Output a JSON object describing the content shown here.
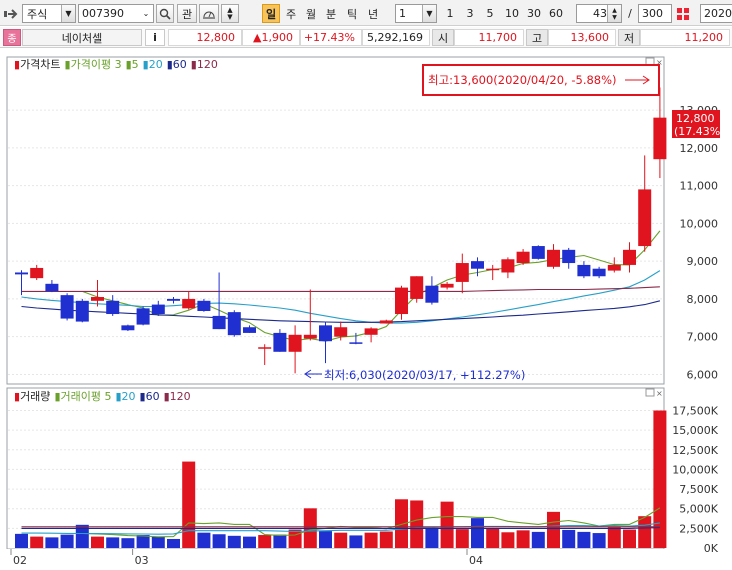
{
  "toolbar": {
    "market_select": "주식",
    "code_input": "007390",
    "gwan_label": "관",
    "period_buttons": [
      "일",
      "주",
      "월",
      "분",
      "틱",
      "년"
    ],
    "active_period": "일",
    "interval_value": "1",
    "quick_intervals": [
      "1",
      "3",
      "5",
      "10",
      "30",
      "60"
    ],
    "count_value": "43",
    "slash": "/",
    "total_value": "300",
    "date_value": "2020/"
  },
  "quote": {
    "name_badge": "종",
    "stock_name": "네이처셀",
    "info_btn": "i",
    "price": "12,800",
    "change": "▲1,900",
    "change_rate": "+17.43%",
    "volume": "5,292,169",
    "open_label": "시",
    "open": "11,700",
    "high_label": "고",
    "high": "13,600",
    "low_label": "저",
    "low": "11,200"
  },
  "colors": {
    "up": "#e0141e",
    "down": "#1f2fd0",
    "ma5": "#6aa12a",
    "ma20": "#27a0c9",
    "ma60": "#1c2a8c",
    "ma120": "#8b2a4b",
    "callout": "#e0141e"
  },
  "price_panel": {
    "legend": [
      {
        "text": "가격차트",
        "color": "#222"
      },
      {
        "text": "가격이평 3",
        "color": "#6aa12a"
      },
      {
        "text": "5",
        "color": "#6aa12a"
      },
      {
        "text": "20",
        "color": "#27a0c9"
      },
      {
        "text": "60",
        "color": "#1c2a8c"
      },
      {
        "text": "120",
        "color": "#8b2a4b"
      }
    ],
    "high_callout": "최고:13,600(2020/04/20, -5.88%)",
    "low_callout": "최저:6,030(2020/03/17, +112.27%)",
    "last_price_tag": "12,800",
    "last_rate_tag": "(17.43%)"
  },
  "volume_panel": {
    "legend": [
      {
        "text": "거래량",
        "color": "#222"
      },
      {
        "text": "거래이평 5",
        "color": "#6aa12a"
      },
      {
        "text": "20",
        "color": "#27a0c9"
      },
      {
        "text": "60",
        "color": "#1c2a8c"
      },
      {
        "text": "120",
        "color": "#8b2a4b"
      }
    ]
  },
  "chart_data": {
    "type": "candlestick",
    "price_axis_ticks": [
      "13,000",
      "12,000",
      "11,000",
      "10,000",
      "9,000",
      "8,000",
      "7,000",
      "6,000"
    ],
    "price_ylim": [
      5800,
      14300
    ],
    "volume_axis_ticks": [
      "17,500K",
      "15,000K",
      "12,500K",
      "10,000K",
      "7,500K",
      "5,000K",
      "2,500K",
      "0K"
    ],
    "volume_ylim": [
      0,
      18200
    ],
    "x_labels": [
      {
        "text": "02",
        "index": 0
      },
      {
        "text": "03",
        "index": 8
      },
      {
        "text": "04",
        "index": 30
      }
    ],
    "candles": [
      {
        "o": 8700,
        "h": 8760,
        "l": 8100,
        "c": 8650,
        "v": 1800
      },
      {
        "o": 8550,
        "h": 8900,
        "l": 8500,
        "c": 8820,
        "v": 1450
      },
      {
        "o": 8400,
        "h": 8500,
        "l": 8180,
        "c": 8200,
        "v": 1350
      },
      {
        "o": 8100,
        "h": 8150,
        "l": 7430,
        "c": 7480,
        "v": 1700
      },
      {
        "o": 7950,
        "h": 8000,
        "l": 7380,
        "c": 7400,
        "v": 2950
      },
      {
        "o": 7950,
        "h": 8500,
        "l": 7800,
        "c": 8050,
        "v": 1450
      },
      {
        "o": 7950,
        "h": 8100,
        "l": 7550,
        "c": 7600,
        "v": 1350
      },
      {
        "o": 7300,
        "h": 7320,
        "l": 7150,
        "c": 7170,
        "v": 1250
      },
      {
        "o": 7750,
        "h": 7800,
        "l": 7300,
        "c": 7320,
        "v": 1650
      },
      {
        "o": 7850,
        "h": 7950,
        "l": 7550,
        "c": 7600,
        "v": 1450
      },
      {
        "o": 8000,
        "h": 8050,
        "l": 7880,
        "c": 7950,
        "v": 1150
      },
      {
        "o": 7750,
        "h": 8200,
        "l": 7720,
        "c": 8000,
        "v": 11000
      },
      {
        "o": 7950,
        "h": 8000,
        "l": 7660,
        "c": 7680,
        "v": 1950
      },
      {
        "o": 7550,
        "h": 8700,
        "l": 7200,
        "c": 7200,
        "v": 1750
      },
      {
        "o": 7650,
        "h": 7700,
        "l": 7000,
        "c": 7040,
        "v": 1550
      },
      {
        "o": 7250,
        "h": 7300,
        "l": 7100,
        "c": 7100,
        "v": 1450
      },
      {
        "o": 6720,
        "h": 6800,
        "l": 6250,
        "c": 6720,
        "v": 1650
      },
      {
        "o": 7100,
        "h": 7200,
        "l": 6600,
        "c": 6600,
        "v": 1700
      },
      {
        "o": 6600,
        "h": 7300,
        "l": 6030,
        "c": 7050,
        "v": 2350
      },
      {
        "o": 6950,
        "h": 8250,
        "l": 6900,
        "c": 7050,
        "v": 5050
      },
      {
        "o": 7300,
        "h": 7400,
        "l": 6300,
        "c": 6880,
        "v": 2150
      },
      {
        "o": 7000,
        "h": 7400,
        "l": 6900,
        "c": 7250,
        "v": 1950
      },
      {
        "o": 6850,
        "h": 7100,
        "l": 6800,
        "c": 6820,
        "v": 1600
      },
      {
        "o": 7050,
        "h": 7250,
        "l": 6850,
        "c": 7220,
        "v": 1950
      },
      {
        "o": 7350,
        "h": 7450,
        "l": 7350,
        "c": 7430,
        "v": 2100
      },
      {
        "o": 7600,
        "h": 8350,
        "l": 7450,
        "c": 8300,
        "v": 6200
      },
      {
        "o": 8000,
        "h": 8600,
        "l": 7900,
        "c": 8600,
        "v": 6050
      },
      {
        "o": 8350,
        "h": 8600,
        "l": 7850,
        "c": 7900,
        "v": 2550
      },
      {
        "o": 8300,
        "h": 8450,
        "l": 8250,
        "c": 8400,
        "v": 5900
      },
      {
        "o": 8450,
        "h": 9200,
        "l": 8150,
        "c": 8950,
        "v": 2400
      },
      {
        "o": 9000,
        "h": 9100,
        "l": 8600,
        "c": 8800,
        "v": 3800
      },
      {
        "o": 8800,
        "h": 8900,
        "l": 8500,
        "c": 8800,
        "v": 2450
      },
      {
        "o": 8700,
        "h": 9100,
        "l": 8550,
        "c": 9050,
        "v": 2000
      },
      {
        "o": 8950,
        "h": 9320,
        "l": 8900,
        "c": 9250,
        "v": 2250
      },
      {
        "o": 9400,
        "h": 9420,
        "l": 9040,
        "c": 9060,
        "v": 2050
      },
      {
        "o": 8850,
        "h": 9450,
        "l": 8800,
        "c": 9300,
        "v": 4600
      },
      {
        "o": 9300,
        "h": 9350,
        "l": 8800,
        "c": 8950,
        "v": 2300
      },
      {
        "o": 8900,
        "h": 9000,
        "l": 8550,
        "c": 8600,
        "v": 2050
      },
      {
        "o": 8800,
        "h": 8850,
        "l": 8550,
        "c": 8600,
        "v": 1900
      },
      {
        "o": 8750,
        "h": 9100,
        "l": 8700,
        "c": 8900,
        "v": 2650
      },
      {
        "o": 8900,
        "h": 9500,
        "l": 8700,
        "c": 9300,
        "v": 2350
      },
      {
        "o": 9400,
        "h": 11800,
        "l": 9250,
        "c": 10900,
        "v": 4050
      },
      {
        "o": 11700,
        "h": 13600,
        "l": 11200,
        "c": 12800,
        "v": 17500
      }
    ],
    "ma_lines": [
      {
        "name": "5",
        "color": "#6aa12a",
        "values": [
          null,
          null,
          null,
          null,
          8200,
          8050,
          7950,
          7850,
          7760,
          7570,
          7580,
          7700,
          7870,
          7700,
          7510,
          7370,
          7110,
          7000,
          6900,
          6950,
          6880,
          6990,
          7020,
          7120,
          7270,
          7700,
          8100,
          8300,
          8500,
          8630,
          8700,
          8780,
          8820,
          8940,
          8970,
          9040,
          9100,
          9150,
          9030,
          8910,
          8900,
          9300,
          9800
        ]
      },
      {
        "name": "20",
        "color": "#27a0c9",
        "values": [
          8050,
          8000,
          7960,
          7930,
          7900,
          7870,
          7850,
          7830,
          7800,
          7800,
          7820,
          7850,
          7880,
          7890,
          7870,
          7840,
          7800,
          7760,
          7700,
          7620,
          7550,
          7480,
          7420,
          7380,
          7360,
          7360,
          7380,
          7420,
          7470,
          7520,
          7580,
          7640,
          7710,
          7780,
          7850,
          7930,
          8000,
          8080,
          8150,
          8230,
          8320,
          8500,
          8750
        ]
      },
      {
        "name": "60",
        "color": "#1c2a8c",
        "values": [
          7800,
          7760,
          7730,
          7700,
          7680,
          7660,
          7640,
          7620,
          7600,
          7580,
          7560,
          7540,
          7520,
          7500,
          7480,
          7460,
          7440,
          7420,
          7410,
          7400,
          7390,
          7380,
          7380,
          7380,
          7390,
          7400,
          7420,
          7440,
          7460,
          7480,
          7500,
          7520,
          7550,
          7570,
          7600,
          7630,
          7660,
          7690,
          7720,
          7750,
          7790,
          7850,
          7950
        ]
      },
      {
        "name": "120",
        "color": "#8b2a4b",
        "values": [
          8200,
          8200,
          8200,
          8200,
          8200,
          8200,
          8200,
          8200,
          8200,
          8200,
          8200,
          8200,
          8200,
          8200,
          8200,
          8200,
          8200,
          8200,
          8200,
          8200,
          8200,
          8200,
          8200,
          8200,
          8200,
          8200,
          8200,
          8200,
          8200,
          8200,
          8210,
          8220,
          8230,
          8240,
          8250,
          8250,
          8250,
          8250,
          8260,
          8270,
          8280,
          8300,
          8320
        ]
      }
    ],
    "vol_ma_lines": [
      {
        "name": "5",
        "color": "#6aa12a",
        "values": [
          null,
          null,
          null,
          null,
          1850,
          1780,
          1700,
          1580,
          1530,
          1430,
          1450,
          3200,
          3100,
          3200,
          3000,
          3000,
          1700,
          1600,
          1650,
          2300,
          2500,
          2750,
          2600,
          2600,
          2450,
          3000,
          3550,
          3870,
          4000,
          4000,
          3900,
          3900,
          3400,
          3200,
          3000,
          3300,
          3500,
          3200,
          2800,
          3000,
          3000,
          3900,
          5100
        ]
      },
      {
        "name": "20",
        "color": "#27a0c9",
        "values": [
          1900,
          1900,
          1880,
          1860,
          1850,
          1830,
          1820,
          1800,
          1780,
          1760,
          1800,
          2200,
          2200,
          2200,
          2200,
          2200,
          2200,
          2150,
          2100,
          2150,
          2200,
          2250,
          2250,
          2250,
          2250,
          2400,
          2550,
          2600,
          2700,
          2700,
          2750,
          2750,
          2750,
          2700,
          2700,
          2800,
          2850,
          2850,
          2800,
          2850,
          2800,
          2900,
          3200
        ]
      },
      {
        "name": "60",
        "color": "#1c2a8c",
        "values": [
          2500,
          2500,
          2500,
          2500,
          2500,
          2500,
          2500,
          2500,
          2500,
          2500,
          2500,
          2500,
          2500,
          2500,
          2500,
          2500,
          2500,
          2500,
          2500,
          2500,
          2500,
          2500,
          2500,
          2500,
          2500,
          2500,
          2500,
          2500,
          2500,
          2500,
          2500,
          2500,
          2500,
          2500,
          2500,
          2500,
          2500,
          2500,
          2500,
          2500,
          2500,
          2550,
          2600
        ]
      },
      {
        "name": "120",
        "color": "#8b2a4b",
        "values": [
          2700,
          2700,
          2700,
          2700,
          2700,
          2700,
          2700,
          2700,
          2700,
          2700,
          2700,
          2700,
          2700,
          2700,
          2700,
          2700,
          2700,
          2700,
          2700,
          2700,
          2700,
          2700,
          2700,
          2700,
          2700,
          2700,
          2700,
          2700,
          2700,
          2700,
          2700,
          2700,
          2700,
          2700,
          2700,
          2700,
          2700,
          2700,
          2700,
          2700,
          2700,
          2700,
          2700
        ]
      }
    ]
  }
}
